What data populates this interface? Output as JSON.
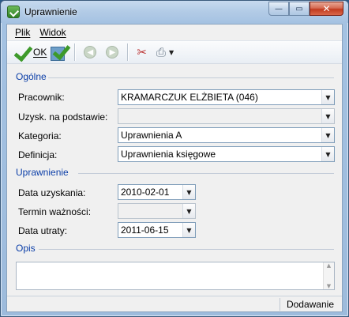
{
  "window": {
    "title": "Uprawnienie"
  },
  "caption_buttons": {
    "minimize": "—",
    "maximize": "▭",
    "close": "✕"
  },
  "menu": {
    "items": [
      "Plik",
      "Widok"
    ]
  },
  "toolbar": {
    "ok_label": "OK"
  },
  "sections": {
    "general": "Ogólne",
    "permission": "Uprawnienie",
    "description": "Opis"
  },
  "fields": {
    "pracownik": {
      "label": "Pracownik:",
      "value": "KRAMARCZUK ELŻBIETA (046)"
    },
    "uzysk": {
      "label": "Uzysk. na podstawie:",
      "value": ""
    },
    "kategoria": {
      "label": "Kategoria:",
      "value": "Uprawnienia A"
    },
    "definicja": {
      "label": "Definicja:",
      "value": "Uprawnienia księgowe"
    },
    "data_uzyskania": {
      "label": "Data uzyskania:",
      "value": "2010-02-01"
    },
    "termin_waznosci": {
      "label": "Termin ważności:",
      "value": ""
    },
    "data_utraty": {
      "label": "Data utraty:",
      "value": "2011-06-15"
    }
  },
  "status": {
    "mode": "Dodawanie"
  },
  "icons": {
    "app": "app-check-icon",
    "ok": "check-icon",
    "save_check": "check-document-icon",
    "back": "back-arrow-icon",
    "forward": "forward-arrow-icon",
    "tools": "tools-icon",
    "print": "printer-icon"
  },
  "colors": {
    "section_heading": "#0b3ea8",
    "check_green": "#3d9a2a"
  }
}
